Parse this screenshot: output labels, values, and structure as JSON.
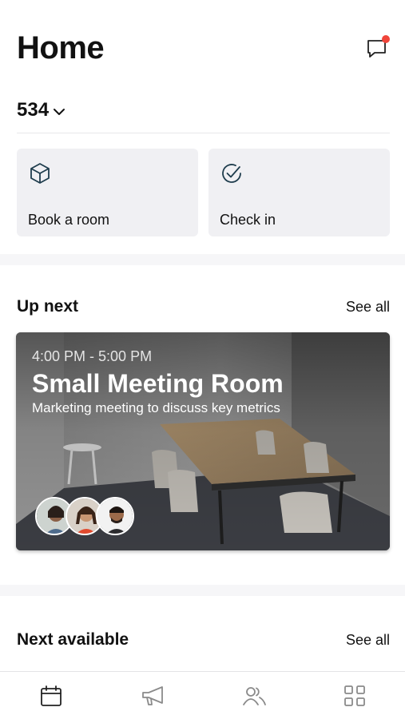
{
  "header": {
    "title": "Home"
  },
  "building": {
    "label": "534"
  },
  "quick_actions": [
    {
      "label": "Book a room",
      "icon": "cube-icon"
    },
    {
      "label": "Check in",
      "icon": "check-circle-icon"
    }
  ],
  "up_next": {
    "title": "Up next",
    "see_all": "See all",
    "card": {
      "time": "4:00 PM - 5:00 PM",
      "room": "Small Meeting Room",
      "subject": "Marketing meeting to discuss key metrics",
      "attendee_count": 3
    }
  },
  "next_available": {
    "title": "Next available",
    "see_all": "See all"
  },
  "tabbar": {
    "items": [
      {
        "icon": "calendar-icon",
        "active": true
      },
      {
        "icon": "megaphone-icon",
        "active": false
      },
      {
        "icon": "people-icon",
        "active": false
      },
      {
        "icon": "apps-grid-icon",
        "active": false
      }
    ]
  },
  "colors": {
    "accent": "#1f3d4d",
    "notification": "#f0453a",
    "tile_bg": "#f0f0f3"
  }
}
